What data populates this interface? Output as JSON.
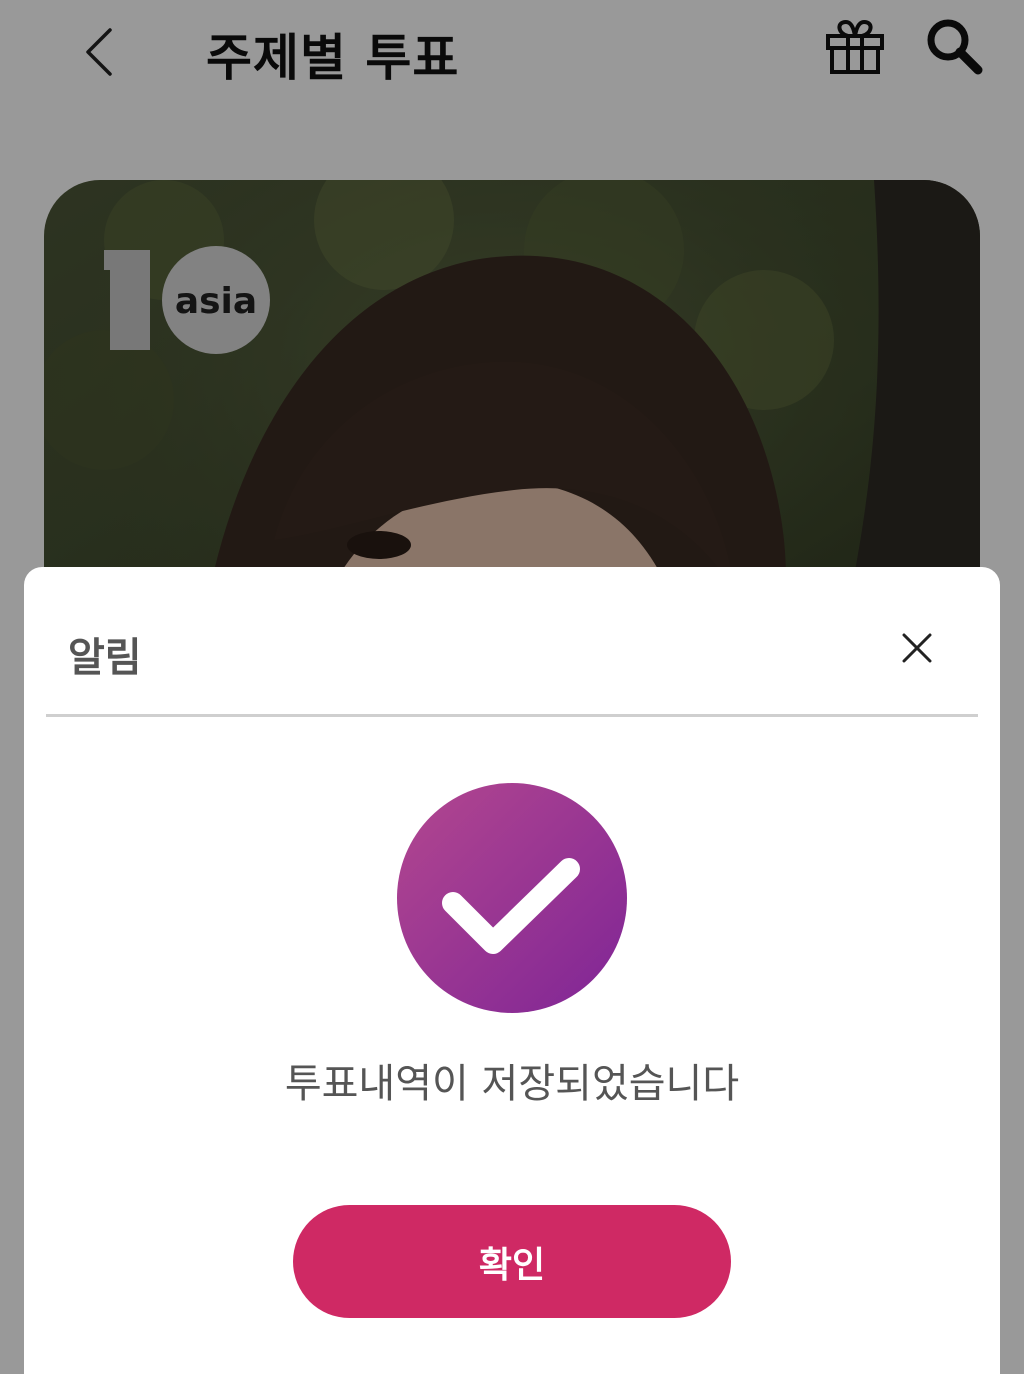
{
  "header": {
    "title": "주제별 투표",
    "back_icon": "chevron-left-icon",
    "gift_icon": "gift-icon",
    "search_icon": "search-icon"
  },
  "hero": {
    "logo_number": "1",
    "logo_text": "asia"
  },
  "dialog": {
    "title": "알림",
    "close_icon": "close-icon",
    "status_icon": "check-circle-icon",
    "message": "투표내역이 저장되었습니다",
    "confirm_label": "확인"
  },
  "colors": {
    "confirm_button": "#cf2964",
    "check_gradient_start": "#b3478f",
    "check_gradient_end": "#7f2596",
    "overlay": "rgba(0,0,0,0.40)"
  }
}
